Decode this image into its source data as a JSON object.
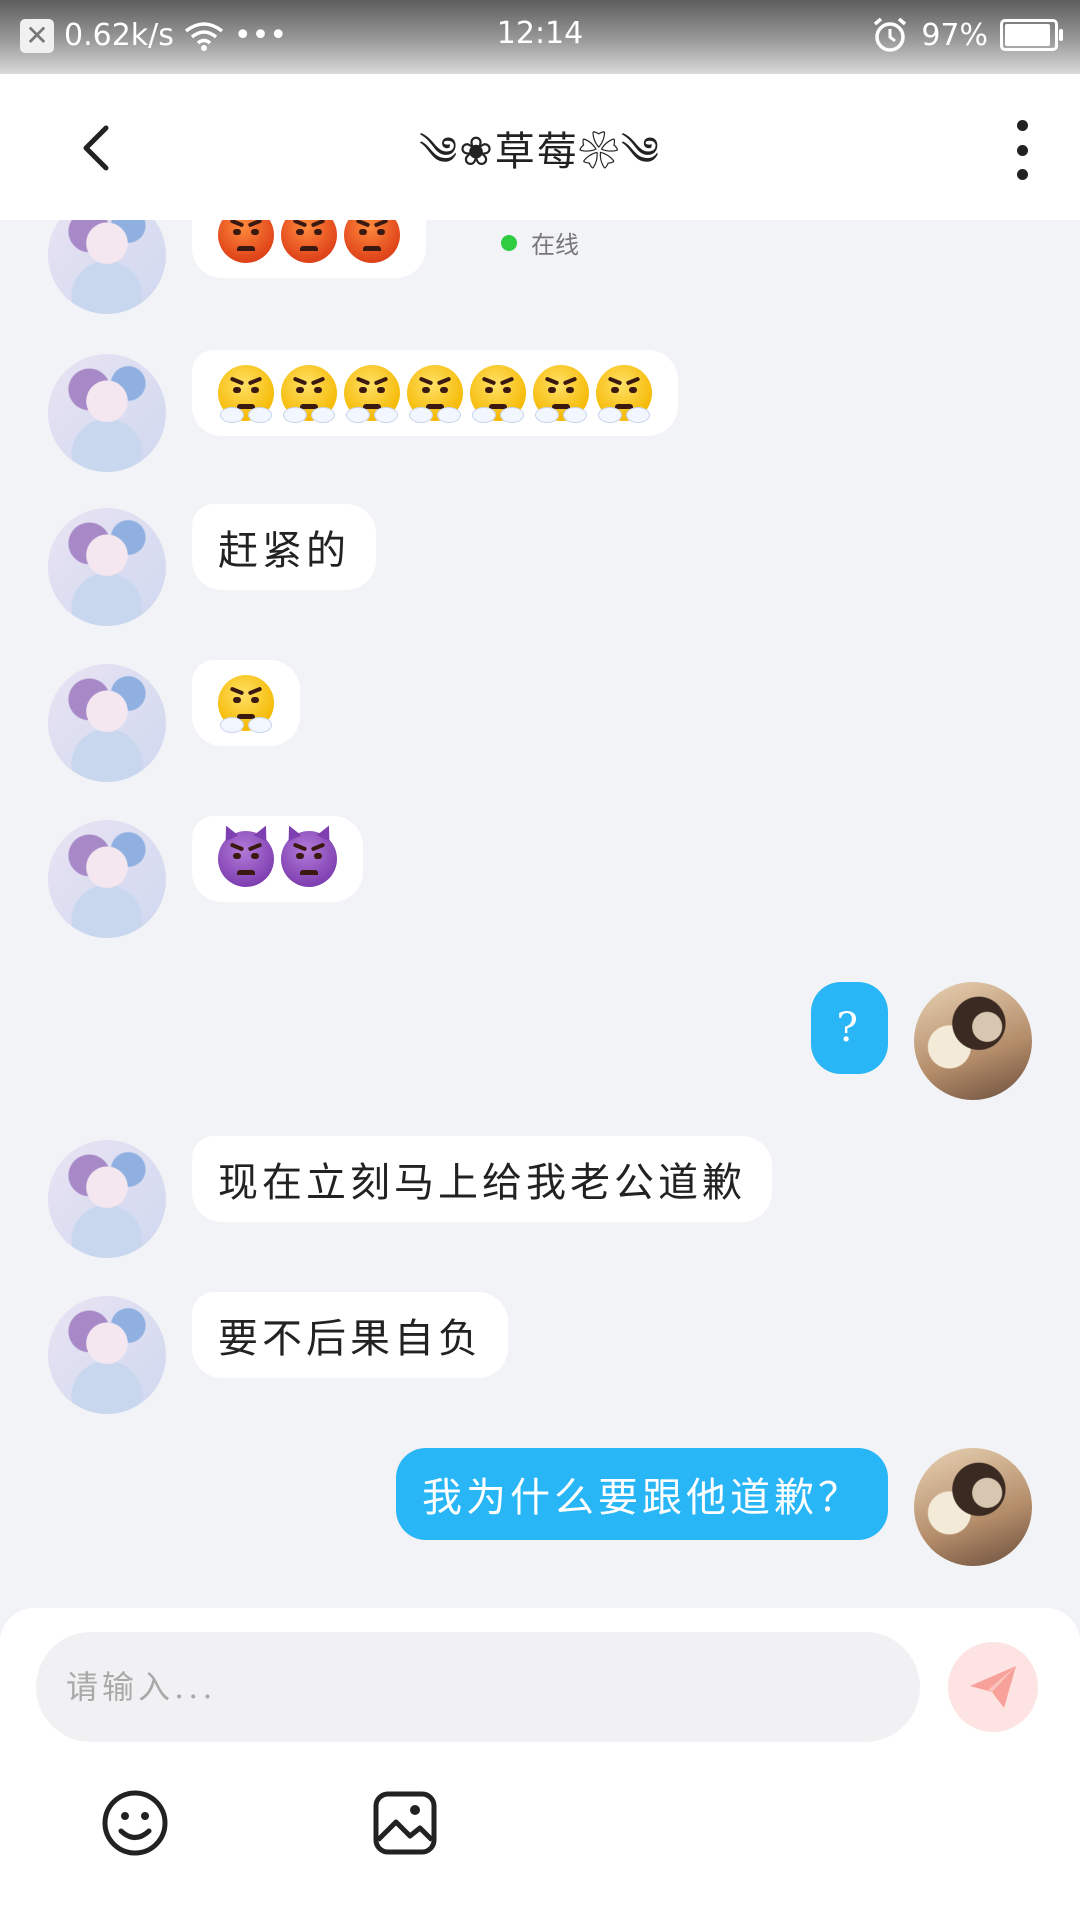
{
  "status_bar": {
    "speed": "0.62k/s",
    "dots": "•••",
    "time": "12:14",
    "battery": "97%",
    "battery_level": 0.97
  },
  "header": {
    "title": "❀草莓❀",
    "title_decor_left": "༄",
    "title_decor_right": "༄",
    "status": "在线"
  },
  "messages": [
    {
      "side": "them",
      "type": "emoji",
      "emoji": [
        "angry-face",
        "angry-face",
        "angry-face"
      ]
    },
    {
      "side": "them",
      "type": "emoji",
      "emoji": [
        "steam-face",
        "steam-face",
        "steam-face",
        "steam-face",
        "steam-face",
        "steam-face",
        "steam-face"
      ]
    },
    {
      "side": "them",
      "type": "text",
      "text": "赶紧的"
    },
    {
      "side": "them",
      "type": "emoji",
      "emoji": [
        "steam-face"
      ]
    },
    {
      "side": "them",
      "type": "emoji",
      "emoji": [
        "angry-devil",
        "angry-devil"
      ]
    },
    {
      "side": "me",
      "type": "text",
      "text": "?"
    },
    {
      "side": "them",
      "type": "text",
      "text": "现在立刻马上给我老公道歉"
    },
    {
      "side": "them",
      "type": "text",
      "text": "要不后果自负"
    },
    {
      "side": "me",
      "type": "text",
      "text": "我为什么要跟他道歉？"
    }
  ],
  "composer": {
    "placeholder": "请输入...",
    "send_icon": "paper-plane-icon",
    "tools": [
      "smiley-icon",
      "image-icon"
    ]
  },
  "colors": {
    "accent": "#29b6f6",
    "online": "#2ecc40",
    "send_bg": "#fde3e1",
    "background": "#f2f3f7"
  }
}
